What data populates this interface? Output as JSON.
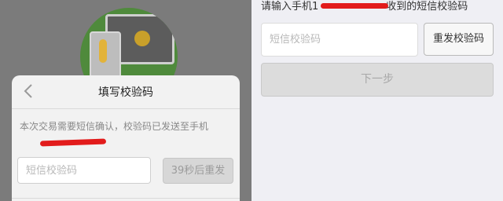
{
  "dialog": {
    "title": "填写校验码",
    "message": "本次交易需要短信确认，校验码已发送至手机",
    "phone_prefix": "",
    "code_placeholder": "短信校验码",
    "countdown_label": "39秒后重发"
  },
  "right": {
    "prompt": "请输入手机1",
    "prompt_suffix": "收到的短信校验码",
    "code_placeholder": "短信校验码",
    "resend_label": "重发校验码",
    "next_label": "下一步"
  },
  "colors": {
    "redaction": "#e21b1b",
    "overlay": "#7b7b7b",
    "illustration_green": "#4f8a3c"
  },
  "icons": {
    "back": "chevron-left-icon"
  }
}
